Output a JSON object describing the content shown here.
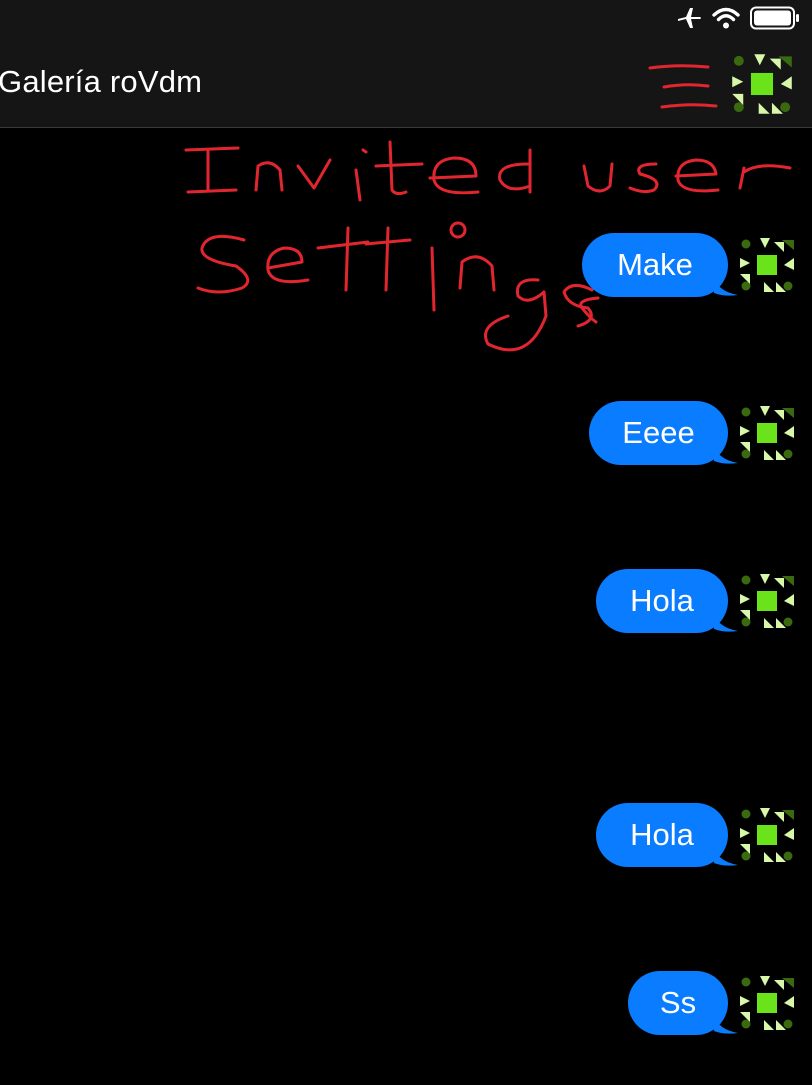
{
  "status_bar": {
    "icons": [
      "airplane-icon",
      "wifi-icon",
      "battery-icon"
    ]
  },
  "header": {
    "title": "Galería roVdm",
    "menu_icon": "hamburger-menu-icon",
    "avatar_icon": "identicon-avatar"
  },
  "annotation": {
    "text": "Invited user settings",
    "color": "#e2262f"
  },
  "messages": [
    {
      "text": "Make"
    },
    {
      "text": "Eeee"
    },
    {
      "text": "Hola"
    },
    {
      "text": "Hola"
    },
    {
      "text": "Ss"
    }
  ],
  "colors": {
    "bubble": "#0a7cff",
    "avatar_bright": "#6be31a",
    "avatar_light": "#d8f7a8",
    "avatar_dark": "#3a6a10"
  }
}
